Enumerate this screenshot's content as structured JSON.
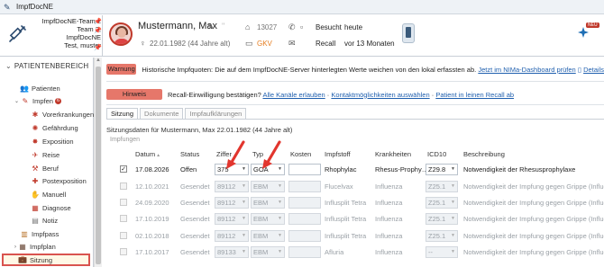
{
  "window": {
    "title": "ImpfDocNE"
  },
  "header": {
    "org_lines": [
      "ImpfDocNE-Team 2",
      "Team 2,",
      "ImpfDocNE",
      "Test, muster"
    ],
    "patient_name": "Mustermann, Max",
    "dob": "22.01.1982 (44 Jahre alt)",
    "patient_id": "13027",
    "insurance": "GKV",
    "besucht_label": "Besucht",
    "besucht_value": "heute",
    "recall_label": "Recall",
    "recall_value": "vor 13 Monaten",
    "new_badge": "NEU"
  },
  "sidebar": {
    "heading": "PATIENTENBEREICH",
    "items": [
      {
        "label": "Patienten"
      },
      {
        "label": "Impfen",
        "badge": "6"
      },
      {
        "label": "Vorerkrankungen"
      },
      {
        "label": "Gefährdung"
      },
      {
        "label": "Exposition"
      },
      {
        "label": "Reise"
      },
      {
        "label": "Beruf"
      },
      {
        "label": "Postexposition"
      },
      {
        "label": "Manuell"
      },
      {
        "label": "Diagnose"
      },
      {
        "label": "Notiz"
      },
      {
        "label": "Impfpass"
      },
      {
        "label": "Impfplan"
      },
      {
        "label": "Sitzung"
      }
    ]
  },
  "alerts": {
    "warning": {
      "tag": "Warnung",
      "text": "Historische Impfquoten: Die auf dem ImpfDocNE-Server hinterlegten Werte weichen von den lokal erfassten ab.",
      "link1": "Jetzt im NIMa-Dashboard prüfen",
      "link2": "Details"
    },
    "hint": {
      "tag": "Hinweis",
      "text": "Recall-Einwilligung bestätigen?",
      "link1": "Alle Kanäle erlauben",
      "link2": "Kontaktmöglichkeiten auswählen",
      "link3": "Patient in leinen Recall ab",
      "sep": "·"
    }
  },
  "tabs": [
    "Sitzung",
    "Dokumente",
    "Impfaufklärungen"
  ],
  "session_info": "Sitzungsdaten für Mustermann, Max 22.01.1982 (44 Jahre alt)",
  "section_label": "Impfungen",
  "table": {
    "headers": [
      "Datum",
      "Status",
      "Ziffer",
      "Typ",
      "Kosten",
      "Impfstoff",
      "Krankheiten",
      "ICD10",
      "Beschreibung"
    ],
    "rows": [
      {
        "checked": true,
        "active": true,
        "date": "17.08.2026",
        "status": "Offen",
        "ziffer": "375",
        "typ": "GOA",
        "kosten": "",
        "impfstoff": "Rhophylac",
        "krankheiten": "Rhesus-Prophy…",
        "icd": "Z29.8",
        "beschreibung": "Notwendigkeit der Rhesusprophylaxe"
      },
      {
        "checked": false,
        "active": false,
        "date": "12.10.2021",
        "status": "Gesendet",
        "ziffer": "89112",
        "typ": "EBM",
        "kosten": "",
        "impfstoff": "Flucelvax",
        "krankheiten": "Influenza",
        "icd": "Z25.1",
        "beschreibung": "Notwendigkeit der Impfung gegen Grippe (Influenza)"
      },
      {
        "checked": false,
        "active": false,
        "date": "24.09.2020",
        "status": "Gesendet",
        "ziffer": "89112",
        "typ": "EBM",
        "kosten": "",
        "impfstoff": "Influsplit Tetra",
        "krankheiten": "Influenza",
        "icd": "Z25.1",
        "beschreibung": "Notwendigkeit der Impfung gegen Grippe (Influenza)"
      },
      {
        "checked": false,
        "active": false,
        "date": "17.10.2019",
        "status": "Gesendet",
        "ziffer": "89112",
        "typ": "EBM",
        "kosten": "",
        "impfstoff": "Influsplit Tetra",
        "krankheiten": "Influenza",
        "icd": "Z25.1",
        "beschreibung": "Notwendigkeit der Impfung gegen Grippe (Influenza)"
      },
      {
        "checked": false,
        "active": false,
        "date": "02.10.2018",
        "status": "Gesendet",
        "ziffer": "89112",
        "typ": "EBM",
        "kosten": "",
        "impfstoff": "Influsplit Tetra",
        "krankheiten": "Influenza",
        "icd": "Z25.1",
        "beschreibung": "Notwendigkeit der Impfung gegen Grippe (Influenza)"
      },
      {
        "checked": false,
        "active": false,
        "date": "17.10.2017",
        "status": "Gesendet",
        "ziffer": "89133",
        "typ": "EBM",
        "kosten": "",
        "impfstoff": "Afluria",
        "krankheiten": "Influenza",
        "icd": "--",
        "beschreibung": "Notwendigkeit der Impfung gegen Grippe (Influenza)"
      }
    ]
  },
  "colors": {
    "accent_red": "#d9534f",
    "tag_red": "#e6776a",
    "link_blue": "#1f5fae",
    "gkv_orange": "#e67e22"
  }
}
